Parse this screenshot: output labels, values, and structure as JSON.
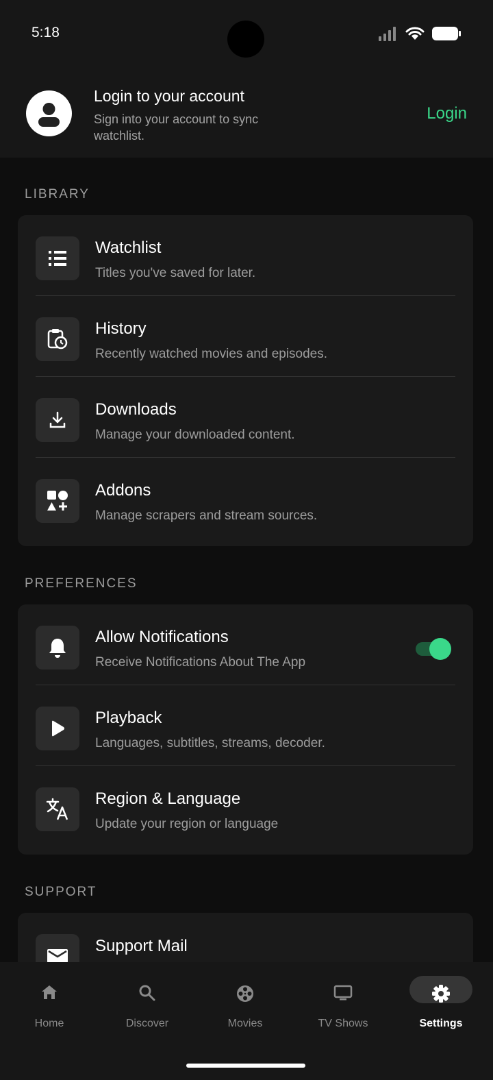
{
  "status_bar": {
    "time": "5:18"
  },
  "account": {
    "title": "Login to your account",
    "subtitle": "Sign into your account to sync watchlist.",
    "login_label": "Login"
  },
  "library": {
    "header": "LIBRARY",
    "items": [
      {
        "title": "Watchlist",
        "subtitle": "Titles you've saved for later.",
        "icon": "list-icon"
      },
      {
        "title": "History",
        "subtitle": "Recently watched movies and episodes.",
        "icon": "history-icon"
      },
      {
        "title": "Downloads",
        "subtitle": "Manage your downloaded content.",
        "icon": "download-icon"
      },
      {
        "title": "Addons",
        "subtitle": "Manage scrapers and stream sources.",
        "icon": "shapes-icon"
      }
    ]
  },
  "preferences": {
    "header": "PREFERENCES",
    "items": [
      {
        "title": "Allow Notifications",
        "subtitle": "Receive Notifications About The App",
        "icon": "bell-icon",
        "toggle_on": true
      },
      {
        "title": "Playback",
        "subtitle": "Languages, subtitles, streams, decoder.",
        "icon": "play-icon"
      },
      {
        "title": "Region & Language",
        "subtitle": "Update your region or language",
        "icon": "translate-icon"
      }
    ]
  },
  "support": {
    "header": "SUPPORT",
    "items": [
      {
        "title": "Support Mail",
        "icon": "mail-icon"
      }
    ]
  },
  "bottom_nav": {
    "items": [
      {
        "label": "Home",
        "icon": "home-icon"
      },
      {
        "label": "Discover",
        "icon": "search-icon"
      },
      {
        "label": "Movies",
        "icon": "film-reel-icon"
      },
      {
        "label": "TV Shows",
        "icon": "tv-icon"
      },
      {
        "label": "Settings",
        "icon": "gear-icon",
        "active": true
      }
    ]
  },
  "colors": {
    "accent": "#3ad88a",
    "background": "#0e0e0e",
    "card": "#1a1a1a"
  }
}
